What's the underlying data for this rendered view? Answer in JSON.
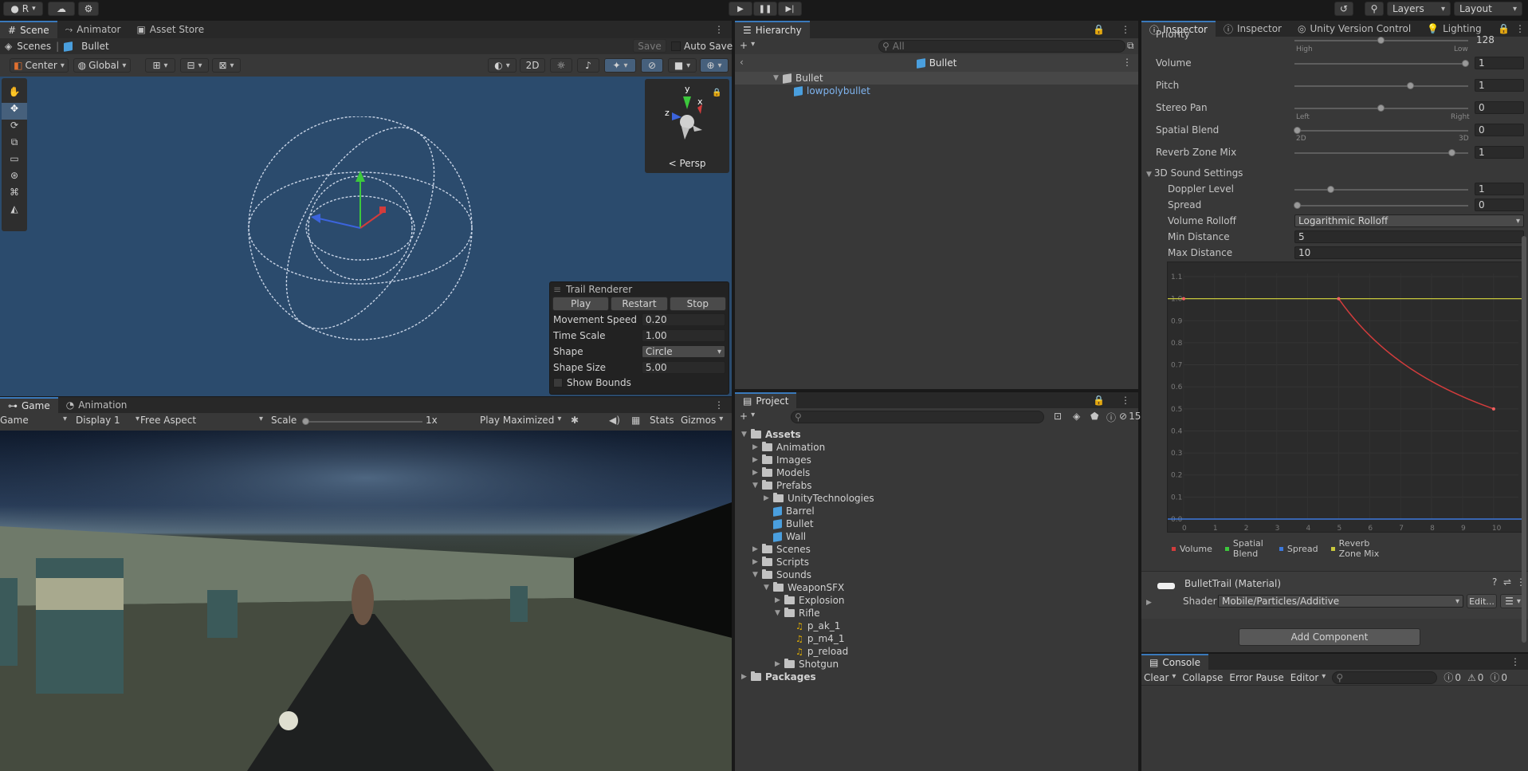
{
  "toolbar": {
    "account_label": "R",
    "layers_label": "Layers",
    "layout_label": "Layout"
  },
  "scene_panel": {
    "tabs": [
      "Scene",
      "Animator",
      "Asset Store"
    ],
    "breadcrumb": [
      "Scenes",
      "Bullet"
    ],
    "save_label": "Save",
    "autosave_label": "Auto Save",
    "pivot_label": "Center",
    "space_label": "Global",
    "mode_2d_label": "2D",
    "gizmo_persp_label": "Persp",
    "trail_renderer": {
      "title": "Trail Renderer",
      "play": "Play",
      "restart": "Restart",
      "stop": "Stop",
      "fields": [
        {
          "label": "Movement Speed",
          "value": "0.20"
        },
        {
          "label": "Time Scale",
          "value": "1.00"
        },
        {
          "label": "Shape",
          "value": "Circle"
        },
        {
          "label": "Shape Size",
          "value": "5.00"
        }
      ],
      "show_bounds_label": "Show Bounds"
    }
  },
  "game_panel": {
    "tabs": [
      "Game",
      "Animation"
    ],
    "game_dropdown": "Game",
    "display_dropdown": "Display 1",
    "aspect_dropdown": "Free Aspect",
    "scale_label": "Scale",
    "scale_value": "1x",
    "play_maximized": "Play Maximized",
    "stats_label": "Stats",
    "gizmos_label": "Gizmos"
  },
  "hierarchy": {
    "title": "Hierarchy",
    "search_placeholder": "All",
    "scene_name": "Bullet",
    "items": [
      {
        "label": "Bullet",
        "depth": 0
      },
      {
        "label": "lowpolybullet",
        "depth": 1
      }
    ]
  },
  "project": {
    "title": "Project",
    "hidden_count": "15",
    "tree": [
      {
        "label": "Assets",
        "depth": 0,
        "type": "folder",
        "bold": true,
        "open": true
      },
      {
        "label": "Animation",
        "depth": 1,
        "type": "folder"
      },
      {
        "label": "Images",
        "depth": 1,
        "type": "folder"
      },
      {
        "label": "Models",
        "depth": 1,
        "type": "folder"
      },
      {
        "label": "Prefabs",
        "depth": 1,
        "type": "folder",
        "open": true
      },
      {
        "label": "UnityTechnologies",
        "depth": 2,
        "type": "folder"
      },
      {
        "label": "Barrel",
        "depth": 2,
        "type": "prefab"
      },
      {
        "label": "Bullet",
        "depth": 2,
        "type": "prefab"
      },
      {
        "label": "Wall",
        "depth": 2,
        "type": "prefab"
      },
      {
        "label": "Scenes",
        "depth": 1,
        "type": "folder"
      },
      {
        "label": "Scripts",
        "depth": 1,
        "type": "folder"
      },
      {
        "label": "Sounds",
        "depth": 1,
        "type": "folder",
        "open": true
      },
      {
        "label": "WeaponSFX",
        "depth": 2,
        "type": "folder",
        "open": true
      },
      {
        "label": "Explosion",
        "depth": 3,
        "type": "folder"
      },
      {
        "label": "Rifle",
        "depth": 3,
        "type": "folder",
        "open": true
      },
      {
        "label": "p_ak_1",
        "depth": 4,
        "type": "audio"
      },
      {
        "label": "p_m4_1",
        "depth": 4,
        "type": "audio"
      },
      {
        "label": "p_reload",
        "depth": 4,
        "type": "audio"
      },
      {
        "label": "Shotgun",
        "depth": 3,
        "type": "folder"
      },
      {
        "label": "Packages",
        "depth": 0,
        "type": "folder",
        "bold": true
      }
    ]
  },
  "inspector": {
    "tabs": [
      "Inspector",
      "Inspector",
      "Unity Version Control",
      "Lighting"
    ],
    "audio": {
      "priority_label": "Priority",
      "priority_value": "128",
      "priority_high": "High",
      "priority_low": "Low",
      "volume_label": "Volume",
      "volume_value": "1",
      "pitch_label": "Pitch",
      "pitch_value": "1",
      "stereo_label": "Stereo Pan",
      "stereo_value": "0",
      "stereo_left": "Left",
      "stereo_right": "Right",
      "spatial_label": "Spatial Blend",
      "spatial_value": "0",
      "spatial_2d": "2D",
      "spatial_3d": "3D",
      "reverb_label": "Reverb Zone Mix",
      "reverb_value": "1"
    },
    "sound3d": {
      "header": "3D Sound Settings",
      "doppler_label": "Doppler Level",
      "doppler_value": "1",
      "spread_label": "Spread",
      "spread_value": "0",
      "rolloff_label": "Volume Rolloff",
      "rolloff_value": "Logarithmic Rolloff",
      "min_label": "Min Distance",
      "min_value": "5",
      "max_label": "Max Distance",
      "max_value": "10"
    },
    "curve": {
      "y_ticks": [
        "1.1",
        "1.0",
        "0.9",
        "0.8",
        "0.7",
        "0.6",
        "0.5",
        "0.4",
        "0.3",
        "0.2",
        "0.1",
        "0.0"
      ],
      "x_ticks": [
        "0",
        "1",
        "2",
        "3",
        "4",
        "5",
        "6",
        "7",
        "8",
        "9",
        "10"
      ],
      "legend": [
        "Volume",
        "Spatial Blend",
        "Spread",
        "Reverb Zone Mix"
      ],
      "legend_colors": [
        "#d23c3c",
        "#3cc83c",
        "#3c78dc",
        "#c8c83c"
      ]
    },
    "material": {
      "title": "BulletTrail (Material)",
      "shader_label": "Shader",
      "shader_value": "Mobile/Particles/Additive",
      "edit_label": "Edit..."
    },
    "add_component": "Add Component"
  },
  "console": {
    "title": "Console",
    "clear": "Clear",
    "collapse": "Collapse",
    "error_pause": "Error Pause",
    "editor": "Editor",
    "log_count": "0",
    "warn_count": "0",
    "error_count": "0"
  }
}
